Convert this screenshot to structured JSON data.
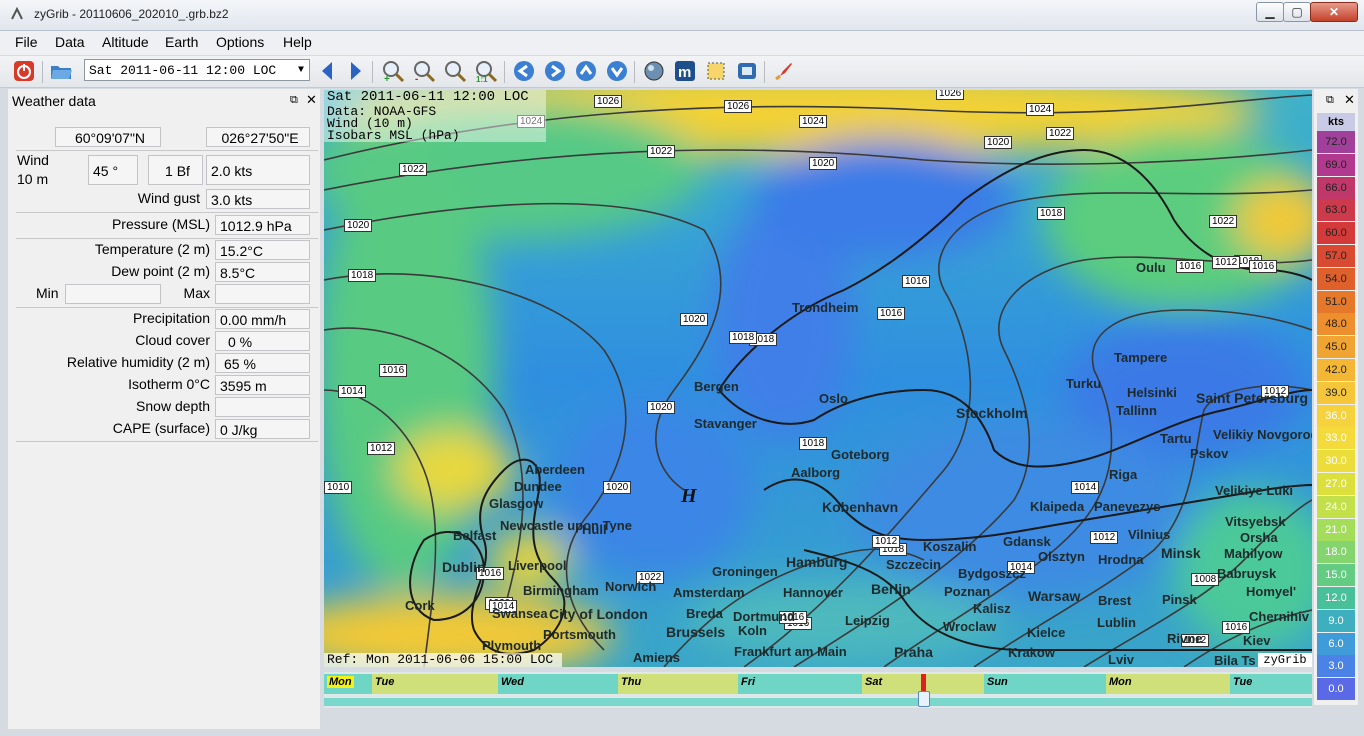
{
  "window": {
    "title": "zyGrib - 20110606_202010_.grb.bz2",
    "minimize": "▁",
    "maximize": "▢",
    "close": "✕"
  },
  "menu": [
    "File",
    "Data",
    "Altitude",
    "Earth",
    "Options",
    "Help"
  ],
  "toolbar": {
    "date_value": "Sat 2011-06-11 12:00 LOC",
    "icons": [
      "power-icon",
      "open-folder-icon",
      "prev-arrow-icon",
      "next-arrow-icon",
      "zoom-in-icon",
      "zoom-out-icon",
      "zoom-select-icon",
      "zoom-all-icon",
      "pan-left-icon",
      "pan-right-icon",
      "pan-up-icon",
      "pan-down-icon",
      "globe-icon",
      "meteogram-icon",
      "select-area-icon",
      "screenshot-icon",
      "rocket-icon"
    ]
  },
  "weather_panel": {
    "title": "Weather data",
    "lat": "60°09'07\"N",
    "lon": "026°27'50\"E",
    "wind_label": "Wind",
    "wind_height": "10 m",
    "wind_dir": "45 °",
    "wind_bf": "1 Bf",
    "wind_speed": "2.0  kts",
    "gust_label": "Wind gust",
    "gust": "3.0  kts",
    "pressure_label": "Pressure (MSL)",
    "pressure": "1012.9 hPa",
    "temp_label": "Temperature (2 m)",
    "temp": "15.2°C",
    "dew_label": "Dew point (2 m)",
    "dew": "8.5°C",
    "min_label": "Min",
    "max_label": "Max",
    "precip_label": "Precipitation",
    "precip": "0.00 mm/h",
    "cloud_label": "Cloud cover",
    "cloud": "0 %",
    "rh_label": "Relative humidity (2 m)",
    "rh": "65 %",
    "iso_label": "Isotherm 0°C",
    "iso": "3595 m",
    "snow_label": "Snow depth",
    "cape_label": "CAPE (surface)",
    "cape": "0 J/kg"
  },
  "map": {
    "overlay": [
      "Sat 2011-06-11 12:00 LOC",
      "Data: NOAA-GFS",
      "Wind (10 m)",
      "Isobars MSL (hPa)"
    ],
    "ref": "Ref: Mon 2011-06-06 15:00 LOC",
    "brand": "zyGrib",
    "high_marker": "H",
    "cities": [
      "Trondheim",
      "Oulu",
      "Bergen",
      "Oslo",
      "Stavanger",
      "Stockholm",
      "Turku",
      "Helsinki",
      "Tampere",
      "Tallinn",
      "Saint Petersburg",
      "Velikiy Novgorod",
      "Tartu",
      "Pskov",
      "Goteborg",
      "Aalborg",
      "Aberdeen",
      "Dundee",
      "Glasgow",
      "Riga",
      "Velikiye Luki",
      "Kobenhavn",
      "Klaipeda",
      "Panevezys",
      "Vitsyebsk",
      "Vilnius",
      "Orsha",
      "Newcastle upon Tyne",
      "Belfast",
      "Dublin",
      "Liverpool",
      "Hull",
      "Groningen",
      "Hamburg",
      "Koszalin",
      "Gdansk",
      "Olsztyn",
      "Hrodna",
      "Minsk",
      "Mahilyow",
      "Szczecin",
      "Bydgoszcz",
      "Babruysk",
      "Homyel'",
      "Cork",
      "Birmingham",
      "Norwich",
      "Amsterdam",
      "Hannover",
      "Berlin",
      "Poznan",
      "Warsaw",
      "Brest",
      "Pinsk",
      "Swansea",
      "City of London",
      "Breda",
      "Dortmund",
      "Kalisz",
      "Chernihiv",
      "Portsmouth",
      "Brussels",
      "Koln",
      "Leipzig",
      "Wroclaw",
      "Kielce",
      "Lublin",
      "Rivne",
      "Kiev",
      "Plymouth",
      "Frankfurt am Main",
      "Praha",
      "Krakow",
      "Lviv",
      "Bila Ts",
      "Amiens"
    ],
    "isobars": [
      "1026",
      "1026",
      "1026",
      "1024",
      "1024",
      "1024",
      "1022",
      "1022",
      "1022",
      "1022",
      "1020",
      "1020",
      "1020",
      "1020",
      "1020",
      "1020",
      "1018",
      "1018",
      "1018",
      "1018",
      "1018",
      "1018",
      "1016",
      "1016",
      "1016",
      "1016",
      "1016",
      "1016",
      "1016",
      "1014",
      "1014",
      "1014",
      "1012",
      "1012",
      "1012",
      "1012",
      "1010",
      "1008",
      "1022",
      "1020",
      "1018",
      "1016",
      "1014",
      "1012",
      "1012",
      "1016"
    ]
  },
  "timeline": {
    "days": [
      "Mon",
      "Tue",
      "Wed",
      "Thu",
      "Fri",
      "Sat",
      "Sun",
      "Mon",
      "Tue"
    ]
  },
  "legend": {
    "unit": "kts",
    "values": [
      "72.0",
      "69.0",
      "66.0",
      "63.0",
      "60.0",
      "57.0",
      "54.0",
      "51.0",
      "48.0",
      "45.0",
      "42.0",
      "39.0",
      "36.0",
      "33.0",
      "30.0",
      "27.0",
      "24.0",
      "21.0",
      "18.0",
      "15.0",
      "12.0",
      "9.0",
      "6.0",
      "3.0",
      "0.0"
    ],
    "colors": [
      "#a0409a",
      "#b13a8f",
      "#c0386a",
      "#cc3a4c",
      "#d43a3a",
      "#da4a33",
      "#e0602c",
      "#e6782a",
      "#ec8f2c",
      "#f0a431",
      "#f4b635",
      "#f5c63a",
      "#f6d23c",
      "#f4da3a",
      "#ecdd3a",
      "#dbe03c",
      "#c3e04a",
      "#a4dd5a",
      "#84d56e",
      "#64cc82",
      "#48c09a",
      "#3eafbe",
      "#3f9cd8",
      "#4b82e6",
      "#5a6ae6"
    ]
  }
}
